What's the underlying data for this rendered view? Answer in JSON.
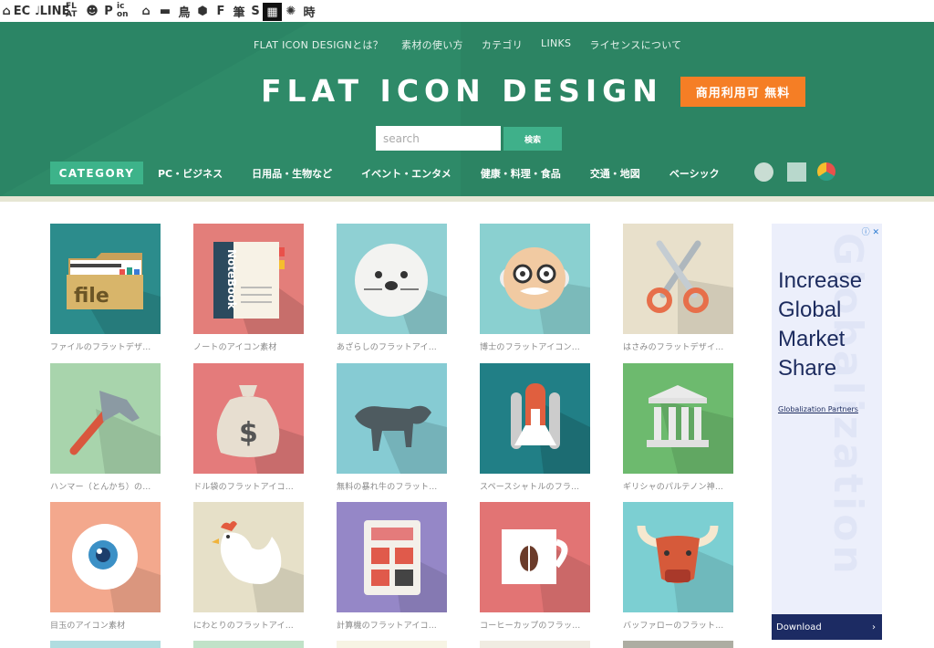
{
  "site_bar": {
    "items": [
      {
        "icon": "home-icon",
        "text": "⌂"
      },
      {
        "icon": "ec-icon",
        "text": "EC"
      },
      {
        "icon": "music-note-icon",
        "text": "♩"
      },
      {
        "icon": "line-icon",
        "text": "LINE"
      },
      {
        "icon": "flat-icon",
        "text": "FL AT"
      },
      {
        "icon": "smile-icon",
        "text": "☻"
      },
      {
        "icon": "p-icon",
        "text": "P"
      },
      {
        "icon": "icon-icon",
        "text": "ic on"
      },
      {
        "icon": "house-icon",
        "text": "⌂"
      },
      {
        "icon": "bed-icon",
        "text": "▬"
      },
      {
        "icon": "bird-icon",
        "text": "鳥"
      },
      {
        "icon": "gem-icon",
        "text": "⬢"
      },
      {
        "icon": "f-icon",
        "text": "F"
      },
      {
        "icon": "brush-icon",
        "text": "筆"
      },
      {
        "icon": "s-icon",
        "text": "S"
      },
      {
        "icon": "grid-icon",
        "text": "▦"
      },
      {
        "icon": "burst-icon",
        "text": "✺"
      },
      {
        "icon": "time-icon",
        "text": "時"
      }
    ]
  },
  "header": {
    "nav": [
      "FLAT ICON DESIGNとは？",
      "素材の使い方",
      "カテゴリ",
      "LINKS",
      "ライセンスについて"
    ],
    "logo": "FLAT ICON DESIGN",
    "badge": "商用利用可 無料",
    "search": {
      "placeholder": "search",
      "button": "検索"
    },
    "category_label": "CATEGORY",
    "categories": [
      "PC・ビジネス",
      "日用品・生物など",
      "イベント・エンタメ",
      "健康・料理・食品",
      "交通・地図",
      "ベーシック"
    ]
  },
  "icons": [
    {
      "caption": "ファイルのフラットデザ…",
      "bg": "#2c8c8c",
      "icon": "folder-icon"
    },
    {
      "caption": "ノートのアイコン素材",
      "bg": "#e37e7a",
      "icon": "notebook-icon"
    },
    {
      "caption": "あざらしのフラットアイ…",
      "bg": "#8fd0d3",
      "icon": "seal-icon"
    },
    {
      "caption": "博士のフラットアイコン…",
      "bg": "#8ad0d0",
      "icon": "professor-icon"
    },
    {
      "caption": "はさみのフラットデザイ…",
      "bg": "#e8e0cb",
      "icon": "scissors-icon"
    },
    {
      "caption": "ハンマー（とんかち）の…",
      "bg": "#a8d4ac",
      "icon": "hammer-icon"
    },
    {
      "caption": "ドル袋のフラットアイコ…",
      "bg": "#e47b7b",
      "icon": "money-bag-icon"
    },
    {
      "caption": "無料の暴れ牛のフラット…",
      "bg": "#86cbd3",
      "icon": "bull-icon"
    },
    {
      "caption": "スペースシャトルのフラ…",
      "bg": "#217f86",
      "icon": "space-shuttle-icon"
    },
    {
      "caption": "ギリシャのパルテノン神…",
      "bg": "#6dba6e",
      "icon": "parthenon-icon"
    },
    {
      "caption": "目玉のアイコン素材",
      "bg": "#f3a88d",
      "icon": "eyeball-icon"
    },
    {
      "caption": "にわとりのフラットアイ…",
      "bg": "#e6e0c8",
      "icon": "chicken-icon"
    },
    {
      "caption": "計算機のフラットアイコ…",
      "bg": "#9587c7",
      "icon": "calculator-icon"
    },
    {
      "caption": "コーヒーカップのフラッ…",
      "bg": "#e27474",
      "icon": "coffee-cup-icon"
    },
    {
      "caption": "バッファローのフラット…",
      "bg": "#7ccfd2",
      "icon": "buffalo-icon"
    }
  ],
  "ad": {
    "headline": [
      "Increase",
      "Global",
      "Market",
      "Share"
    ],
    "watermark": "Globalization",
    "brand": "Globalization Partners",
    "cta": "Download",
    "info_mark": "ⓘ ✕"
  }
}
